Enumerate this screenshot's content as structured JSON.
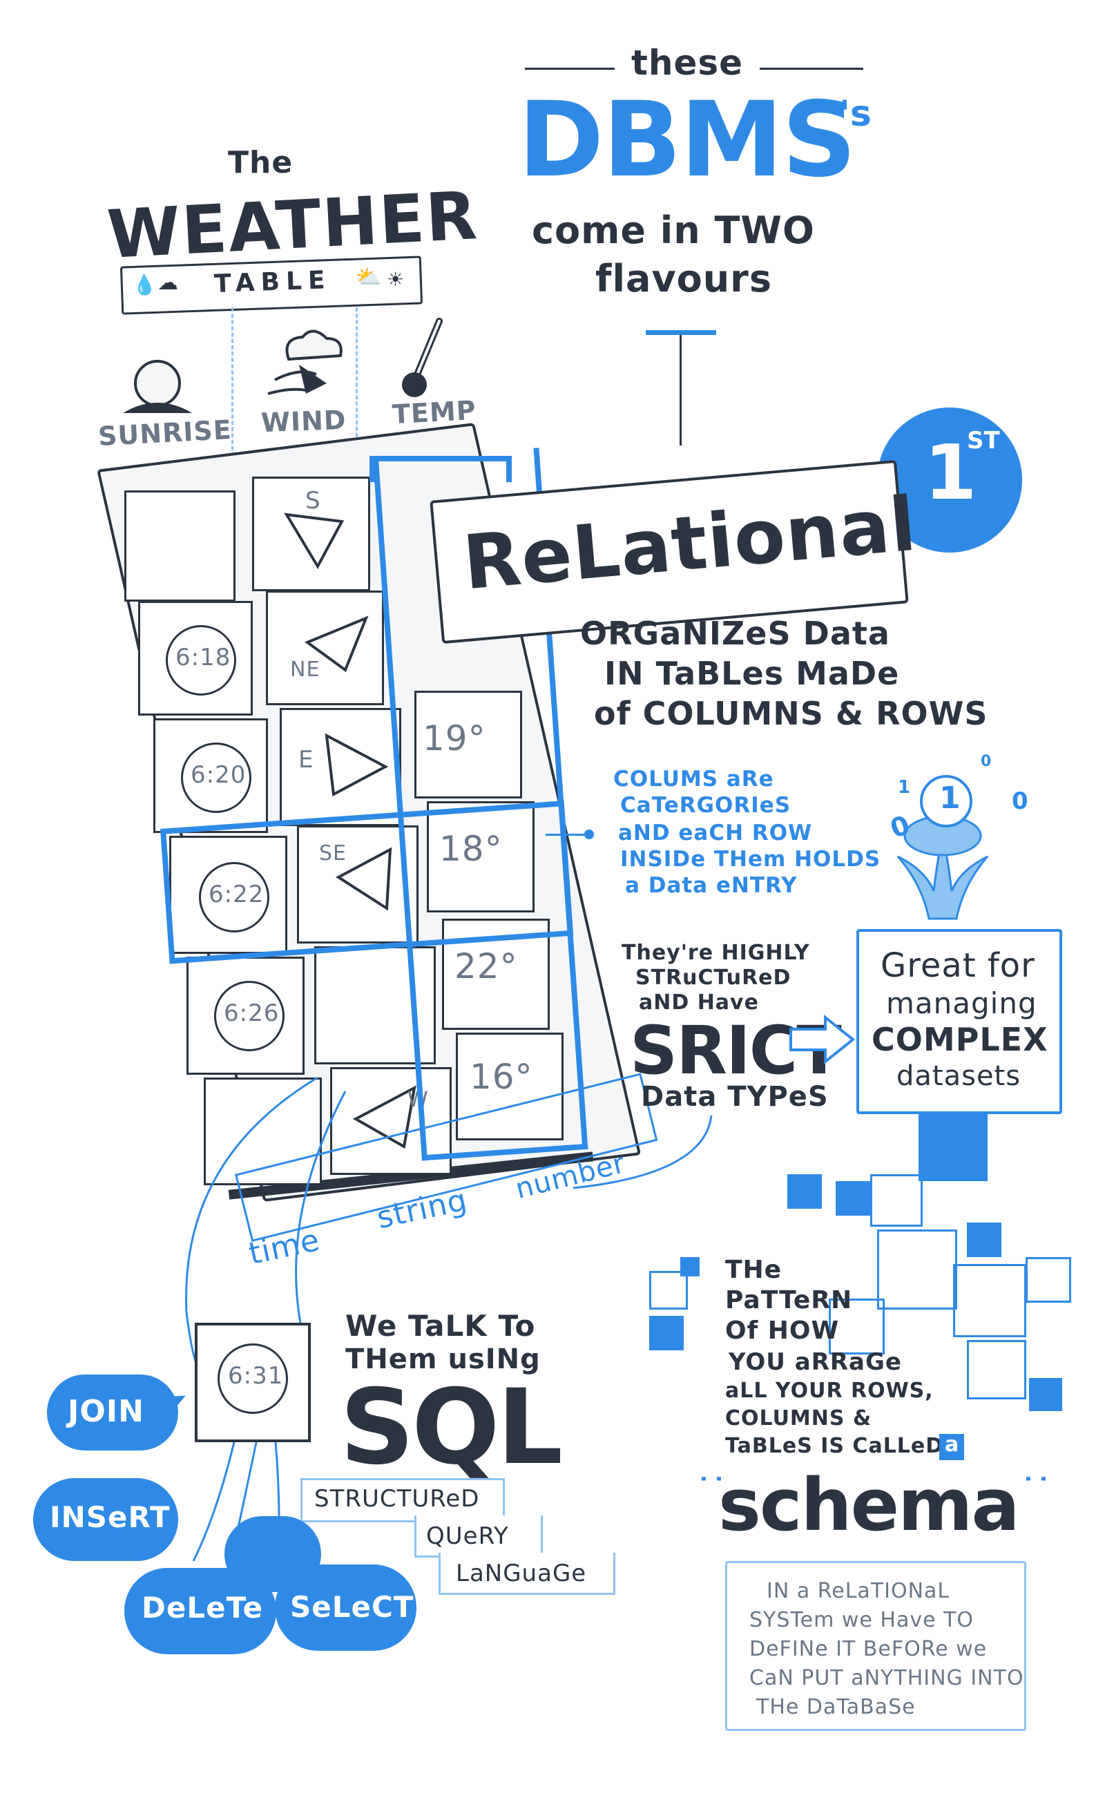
{
  "header": {
    "these": "these",
    "dbms": "DBMS",
    "dbms_suffix": "'s",
    "come_in_two": "come in TWO",
    "flavours": "flavours"
  },
  "weather": {
    "the": "The",
    "weather": "WEATHER",
    "table": "TABLE",
    "columns": [
      "SUNRISE",
      "WIND",
      "TEMP"
    ]
  },
  "grid": {
    "sunrise": [
      "",
      "6:18",
      "6:20",
      "6:22",
      "6:26",
      ""
    ],
    "wind": [
      "S",
      "NE",
      "E",
      "SE",
      "",
      "W"
    ],
    "temp": [
      "19°",
      "18°",
      "22°",
      "16°"
    ],
    "types": [
      "time",
      "string",
      "number"
    ]
  },
  "relational": {
    "badge_num": "1",
    "badge_sup": "ST",
    "label": "ReLational",
    "desc": [
      "ORGaNIZeS Data",
      "IN TaBLes MaDe",
      "of COLUMNS & ROWS"
    ],
    "note": [
      "COLUMS aRe",
      "CaTeRGORIeS",
      "aND eaCH ROW",
      "INSIDe THem HOLDS",
      "a Data eNTRY"
    ],
    "strict_pre": [
      "They're HIGHLY",
      "STRuCTuReD",
      "aND Have"
    ],
    "strict": "SRICT",
    "strict_post": "Data TYPeS",
    "great": [
      "Great for",
      "managing",
      "COMPLEX",
      "datasets"
    ],
    "splash_digits": [
      "1",
      "0",
      "0",
      "1",
      "0"
    ]
  },
  "sql": {
    "intro": [
      "We TaLK To",
      "THem usINg"
    ],
    "title": "SQL",
    "expansion": [
      "STRUCTUReD",
      "QUeRY",
      "LaNGuaGe"
    ],
    "cell": "6:31",
    "commands": [
      "JOIN",
      "INSeRT",
      "DeLeTe",
      "SeLeCT"
    ]
  },
  "schema": {
    "pattern": [
      "THe",
      "PaTTeRN",
      "Of HOW",
      "YOU aRRaGe",
      "aLL YOUR ROWS,",
      "COLUMNS &",
      "TaBLeS IS CaLLeD"
    ],
    "article": "a",
    "title": "schema",
    "note": [
      "IN a ReLaTIONaL",
      "SYSTem we Have TO",
      "DeFINe IT BeFORe we",
      "CaN PUT aNYTHING INTO",
      "THe DaTaBaSe"
    ]
  },
  "colors": {
    "ink": "#2b3440",
    "blue": "#2f8ae6",
    "light_blue": "#8ec4f2",
    "paper": "#f4f6f8"
  }
}
